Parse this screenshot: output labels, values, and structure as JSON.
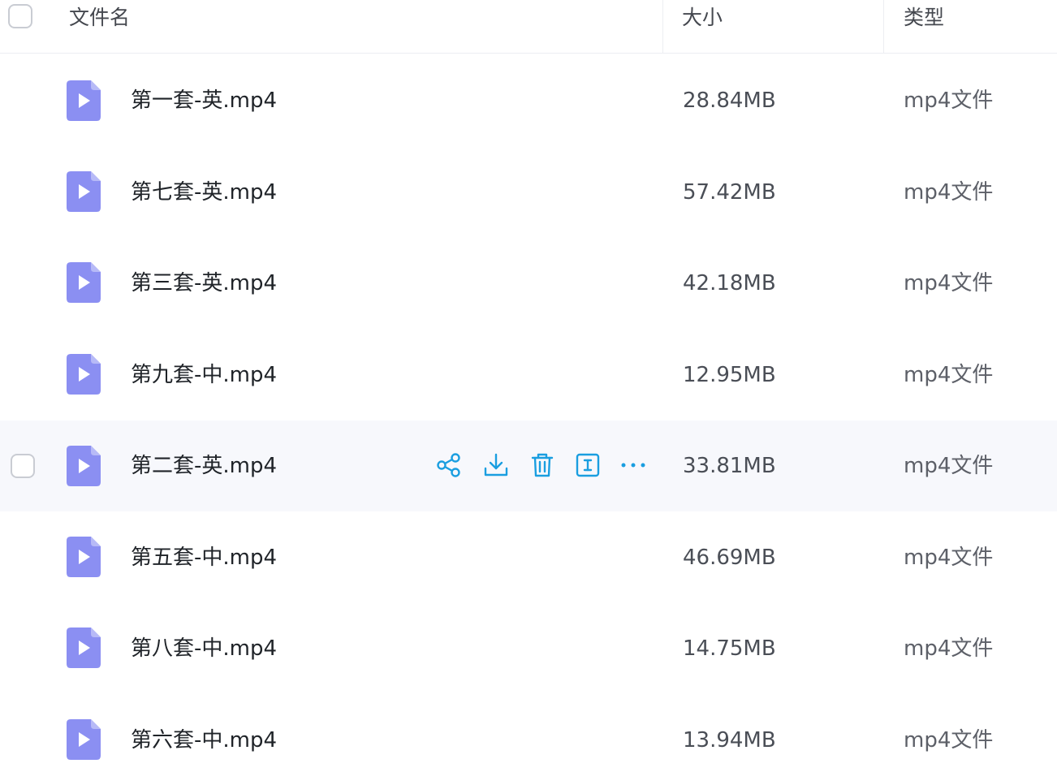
{
  "header": {
    "name": "文件名",
    "size": "大小",
    "type": "类型"
  },
  "colors": {
    "accent": "#1a9ee0",
    "icon_fill": "#8b8ff2",
    "hover_bg": "#f7f8fc"
  },
  "row_actions": [
    "share-icon",
    "download-icon",
    "delete-icon",
    "rename-icon",
    "more-icon"
  ],
  "files": [
    {
      "name": "第一套-英.mp4",
      "size": "28.84MB",
      "type": "mp4文件"
    },
    {
      "name": "第七套-英.mp4",
      "size": "57.42MB",
      "type": "mp4文件"
    },
    {
      "name": "第三套-英.mp4",
      "size": "42.18MB",
      "type": "mp4文件"
    },
    {
      "name": "第九套-中.mp4",
      "size": "12.95MB",
      "type": "mp4文件"
    },
    {
      "name": "第二套-英.mp4",
      "size": "33.81MB",
      "type": "mp4文件",
      "hovered": true
    },
    {
      "name": "第五套-中.mp4",
      "size": "46.69MB",
      "type": "mp4文件"
    },
    {
      "name": "第八套-中.mp4",
      "size": "14.75MB",
      "type": "mp4文件"
    },
    {
      "name": "第六套-中.mp4",
      "size": "13.94MB",
      "type": "mp4文件"
    }
  ]
}
